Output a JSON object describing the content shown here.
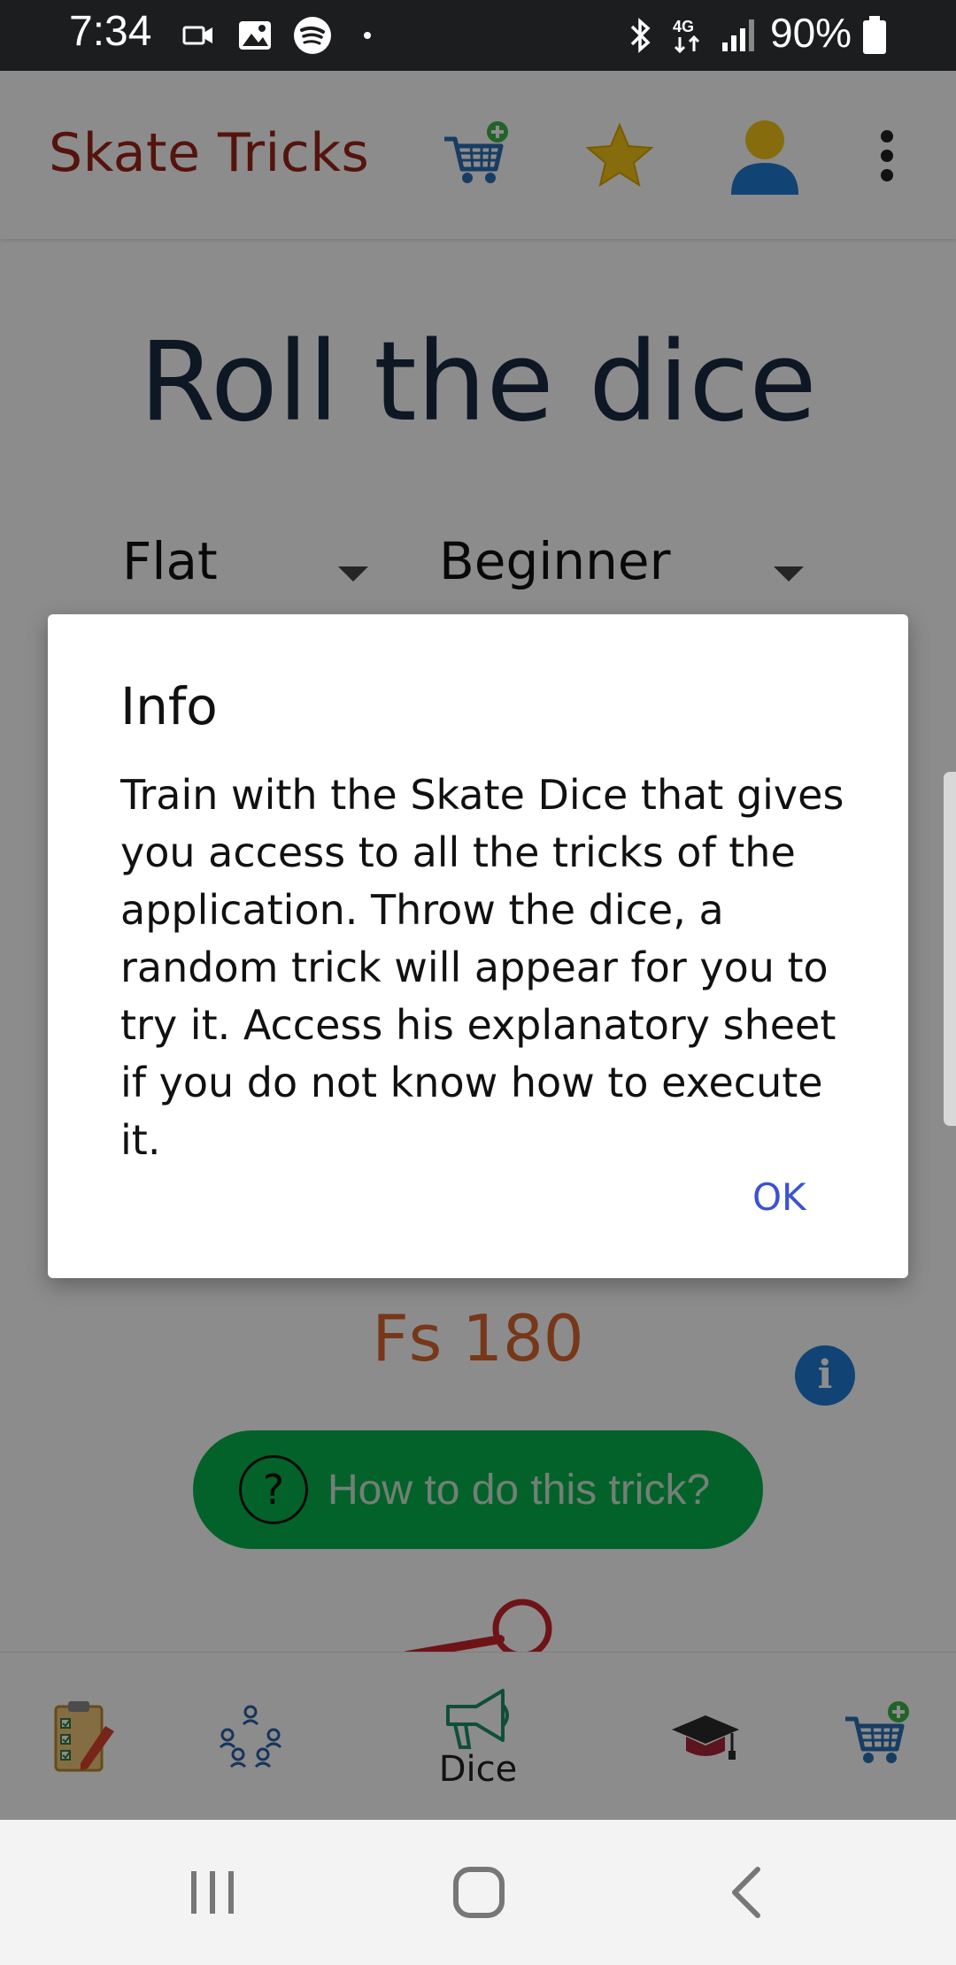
{
  "status_bar": {
    "time": "7:34",
    "battery": "90%",
    "network": "4G"
  },
  "app_bar": {
    "title": "Skate Tricks",
    "actions": [
      "cart-add-icon",
      "star-icon",
      "account-icon",
      "more-vert-icon"
    ]
  },
  "content": {
    "title": "Roll the dice",
    "terrain_select": "Flat",
    "level_select": "Beginner",
    "trick_name": "Fs 180",
    "info_icon": "i",
    "howto_label": "How to do this trick?",
    "howto_icon": "?"
  },
  "dialog": {
    "title": "Info",
    "message": "Train with the Skate Dice that gives you access to all the tricks of the application. Throw the dice, a random trick will appear for you to try it. Access his explanatory sheet if you do not know how to execute it.",
    "ok_label": "OK"
  },
  "bottom_nav": {
    "items": [
      {
        "icon": "checklist-icon",
        "label": ""
      },
      {
        "icon": "community-icon",
        "label": ""
      },
      {
        "icon": "megaphone-icon",
        "label": "Dice"
      },
      {
        "icon": "graduation-cap-icon",
        "label": ""
      },
      {
        "icon": "cart-add-icon",
        "label": ""
      }
    ]
  },
  "colors": {
    "app_title": "#9b2318",
    "accent_blue": "#3a52d4",
    "howto_green": "#07b34e",
    "trick_orange": "#d9642f"
  }
}
